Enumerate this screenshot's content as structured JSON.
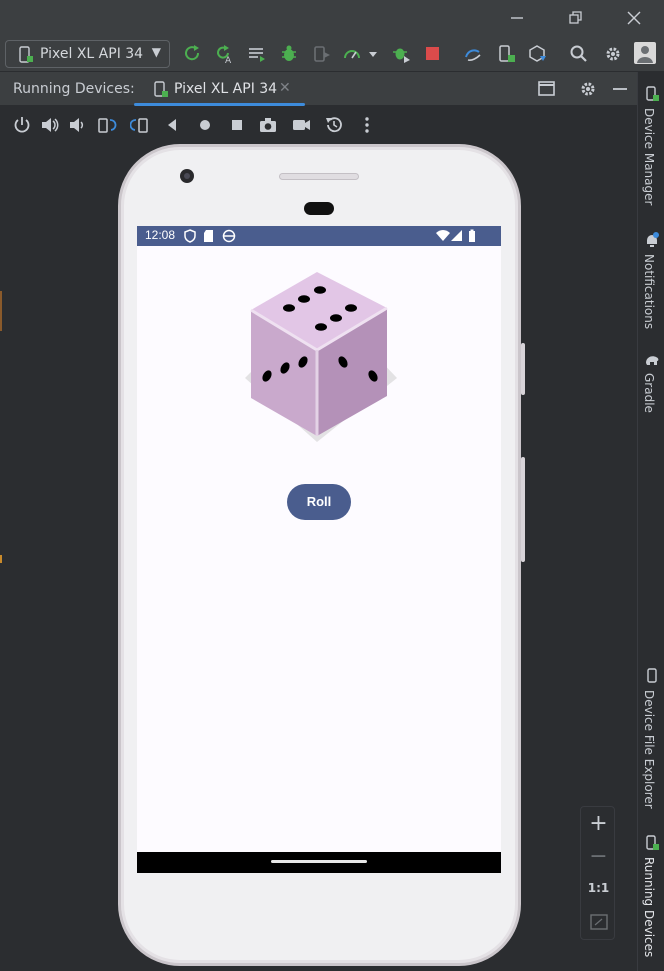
{
  "toolbar": {
    "device_selector": "Pixel XL API 34"
  },
  "tool_window": {
    "title": "Running Devices:",
    "tab_label": "Pixel XL API 34"
  },
  "side_panels": {
    "device_manager": "Device Manager",
    "notifications": "Notifications",
    "gradle": "Gradle",
    "device_file_explorer": "Device File Explorer",
    "running_devices": "Running Devices"
  },
  "phone": {
    "status_time": "12:08",
    "roll_label": "Roll"
  },
  "zoom": {
    "plus": "+",
    "minus": "−",
    "actual_size": "1:1"
  },
  "colors": {
    "accent": "#3d8bdb",
    "app_primary": "#4a5d8e",
    "dice_top": "#e2c6e6",
    "dice_left": "#c9a9cc",
    "dice_right": "#b491b8",
    "run_green": "#4caf50",
    "stop_red": "#db4b4b"
  }
}
